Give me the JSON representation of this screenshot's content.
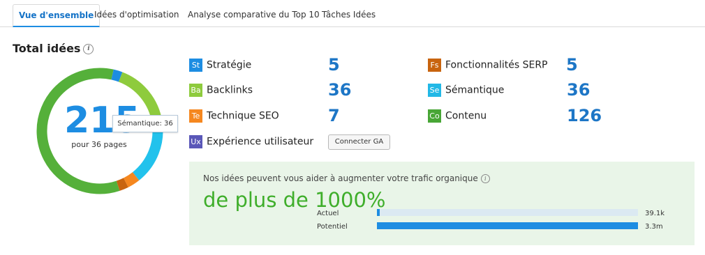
{
  "tabs": [
    {
      "label": "Vue d'ensemble",
      "active": true
    },
    {
      "label": "Idées d'optimisation",
      "active": false
    },
    {
      "label": "Analyse comparative du Top 10",
      "active": false
    },
    {
      "label": "Tâches Idées",
      "active": false
    }
  ],
  "summary": {
    "title": "Total idées",
    "info_icon": "i",
    "total": "215",
    "total_sub": "pour 36 pages",
    "tooltip": "Sémantique: 36"
  },
  "donut_segments": [
    {
      "name": "Contenu",
      "value": 126,
      "color": "#55b03a"
    },
    {
      "name": "Stratégie",
      "value": 5,
      "color": "#1d8de2"
    },
    {
      "name": "Backlinks",
      "value": 36,
      "color": "#8ecb3d"
    },
    {
      "name": "Sémantique",
      "value": 36,
      "color": "#22c2ec"
    },
    {
      "name": "Technique SEO",
      "value": 7,
      "color": "#f5871f"
    },
    {
      "name": "Fonctionnalités SERP",
      "value": 5,
      "color": "#c8640f"
    }
  ],
  "categories": {
    "strategie": {
      "badge": "St",
      "label": "Stratégie",
      "value": "5",
      "color": "#1d8de2"
    },
    "backlinks": {
      "badge": "Ba",
      "label": "Backlinks",
      "value": "36",
      "color": "#8ecb3d"
    },
    "technique": {
      "badge": "Te",
      "label": "Technique SEO",
      "value": "7",
      "color": "#f5871f"
    },
    "ux": {
      "badge": "Ux",
      "label": "Expérience utilisateur",
      "button": "Connecter GA",
      "color": "#5a57b8"
    },
    "serp": {
      "badge": "Fs",
      "label": "Fonctionnalités SERP",
      "value": "5",
      "color": "#c8640f"
    },
    "semantique": {
      "badge": "Se",
      "label": "Sémantique",
      "value": "36",
      "color": "#22b8e6"
    },
    "contenu": {
      "badge": "Co",
      "label": "Contenu",
      "value": "126",
      "color": "#48a636"
    }
  },
  "promo": {
    "text": "Nos idées peuvent vous aider à augmenter votre trafic organique",
    "big": "de plus de 1000%",
    "bars": [
      {
        "label": "Actuel",
        "value": "39.1k",
        "fraction": 0.012
      },
      {
        "label": "Potentiel",
        "value": "3.3m",
        "fraction": 1.0
      }
    ]
  }
}
